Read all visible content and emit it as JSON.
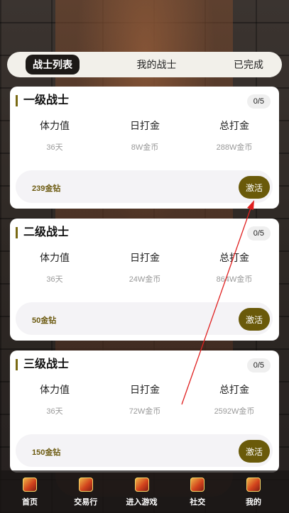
{
  "tabs": [
    {
      "label": "战士列表",
      "active": true
    },
    {
      "label": "我的战士",
      "active": false
    },
    {
      "label": "已完成",
      "active": false
    }
  ],
  "columns": [
    "体力值",
    "日打金",
    "总打金"
  ],
  "cards": [
    {
      "title": "一级战士",
      "count": "0/5",
      "values": [
        "36天",
        "8W金币",
        "288W金币"
      ],
      "price": "239金钻",
      "button": "激活"
    },
    {
      "title": "二级战士",
      "count": "0/5",
      "values": [
        "36天",
        "24W金币",
        "864W金币"
      ],
      "price": "50金钻",
      "button": "激活"
    },
    {
      "title": "三级战士",
      "count": "0/5",
      "values": [
        "36天",
        "72W金币",
        "2592W金币"
      ],
      "price": "150金钻",
      "button": "激活"
    }
  ],
  "nav": [
    {
      "label": "首页",
      "icon": "game-icon"
    },
    {
      "label": "交易行",
      "icon": "game-icon"
    },
    {
      "label": "进入游戏",
      "icon": "game-icon"
    },
    {
      "label": "社交",
      "icon": "game-icon"
    },
    {
      "label": "我的",
      "icon": "game-icon"
    }
  ],
  "colors": {
    "accent": "#6a5a0a",
    "annotation": "#e02020"
  }
}
